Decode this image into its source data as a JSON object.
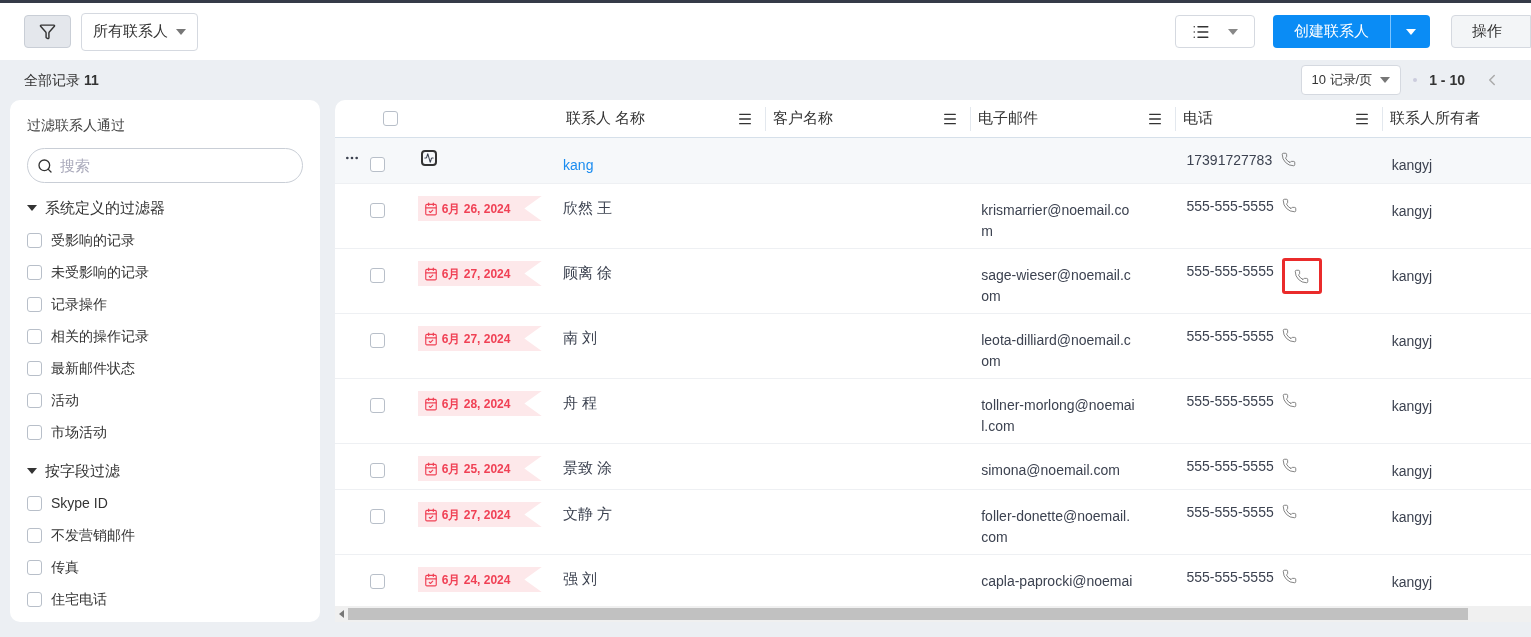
{
  "toolbar": {
    "view_select": "所有联系人",
    "create_button": "创建联系人",
    "actions_button": "操作"
  },
  "summary": {
    "label": "全部记录",
    "count": "11"
  },
  "pagination": {
    "page_size": "10 记录/页",
    "range": "1 - 10"
  },
  "sidebar": {
    "title": "过滤联系人通过",
    "search": {
      "placeholder": "搜索"
    },
    "groups": [
      {
        "title": "系统定义的过滤器",
        "expanded": true,
        "items": [
          {
            "label": "受影响的记录",
            "checked": false
          },
          {
            "label": "未受影响的记录",
            "checked": false
          },
          {
            "label": "记录操作",
            "checked": false
          },
          {
            "label": "相关的操作记录",
            "checked": false
          },
          {
            "label": "最新邮件状态",
            "checked": false
          },
          {
            "label": "活动",
            "checked": false
          },
          {
            "label": "市场活动",
            "checked": false
          }
        ]
      },
      {
        "title": "按字段过滤",
        "expanded": true,
        "items": [
          {
            "label": "Skype ID",
            "checked": false
          },
          {
            "label": "不发营销邮件",
            "checked": false
          },
          {
            "label": "传真",
            "checked": false
          },
          {
            "label": "住宅电话",
            "checked": false
          }
        ]
      }
    ]
  },
  "table": {
    "select_all": false,
    "columns": [
      "联系人 名称",
      "客户名称",
      "电子邮件",
      "电话",
      "联系人所有者"
    ],
    "rows": [
      {
        "kind": "activity",
        "selected": false,
        "name": "kang",
        "email": "",
        "phone": "17391727783",
        "owner": "kangyj",
        "phone_highlighted": false
      },
      {
        "kind": "date",
        "date": "6月 26, 2024",
        "selected": false,
        "name": "欣然 王",
        "email": "krismarrier@noemail.com",
        "phone": "555-555-5555",
        "owner": "kangyj",
        "phone_highlighted": false
      },
      {
        "kind": "date",
        "date": "6月 27, 2024",
        "selected": false,
        "name": "顾离 徐",
        "email": "sage-wieser@noemail.com",
        "phone": "555-555-5555",
        "owner": "kangyj",
        "phone_highlighted": true
      },
      {
        "kind": "date",
        "date": "6月 27, 2024",
        "selected": false,
        "name": "南 刘",
        "email": "leota-dilliard@noemail.com",
        "phone": "555-555-5555",
        "owner": "kangyj",
        "phone_highlighted": false
      },
      {
        "kind": "date",
        "date": "6月 28, 2024",
        "selected": false,
        "name": "舟 程",
        "email": "tollner-morlong@noemail.com",
        "phone": "555-555-5555",
        "owner": "kangyj",
        "phone_highlighted": false
      },
      {
        "kind": "date",
        "date": "6月 25, 2024",
        "selected": false,
        "name": "景致 涂",
        "email": "simona@noemail.com",
        "phone": "555-555-5555",
        "owner": "kangyj",
        "phone_highlighted": false
      },
      {
        "kind": "date",
        "date": "6月 27, 2024",
        "selected": false,
        "name": "文静 方",
        "email": "foller-donette@noemail.com",
        "phone": "555-555-5555",
        "owner": "kangyj",
        "phone_highlighted": false
      },
      {
        "kind": "date",
        "date": "6月 24, 2024",
        "selected": false,
        "name": "强 刘",
        "email": "capla-paprocki@noemai",
        "phone": "555-555-5555",
        "owner": "kangyj",
        "phone_highlighted": false
      }
    ]
  }
}
